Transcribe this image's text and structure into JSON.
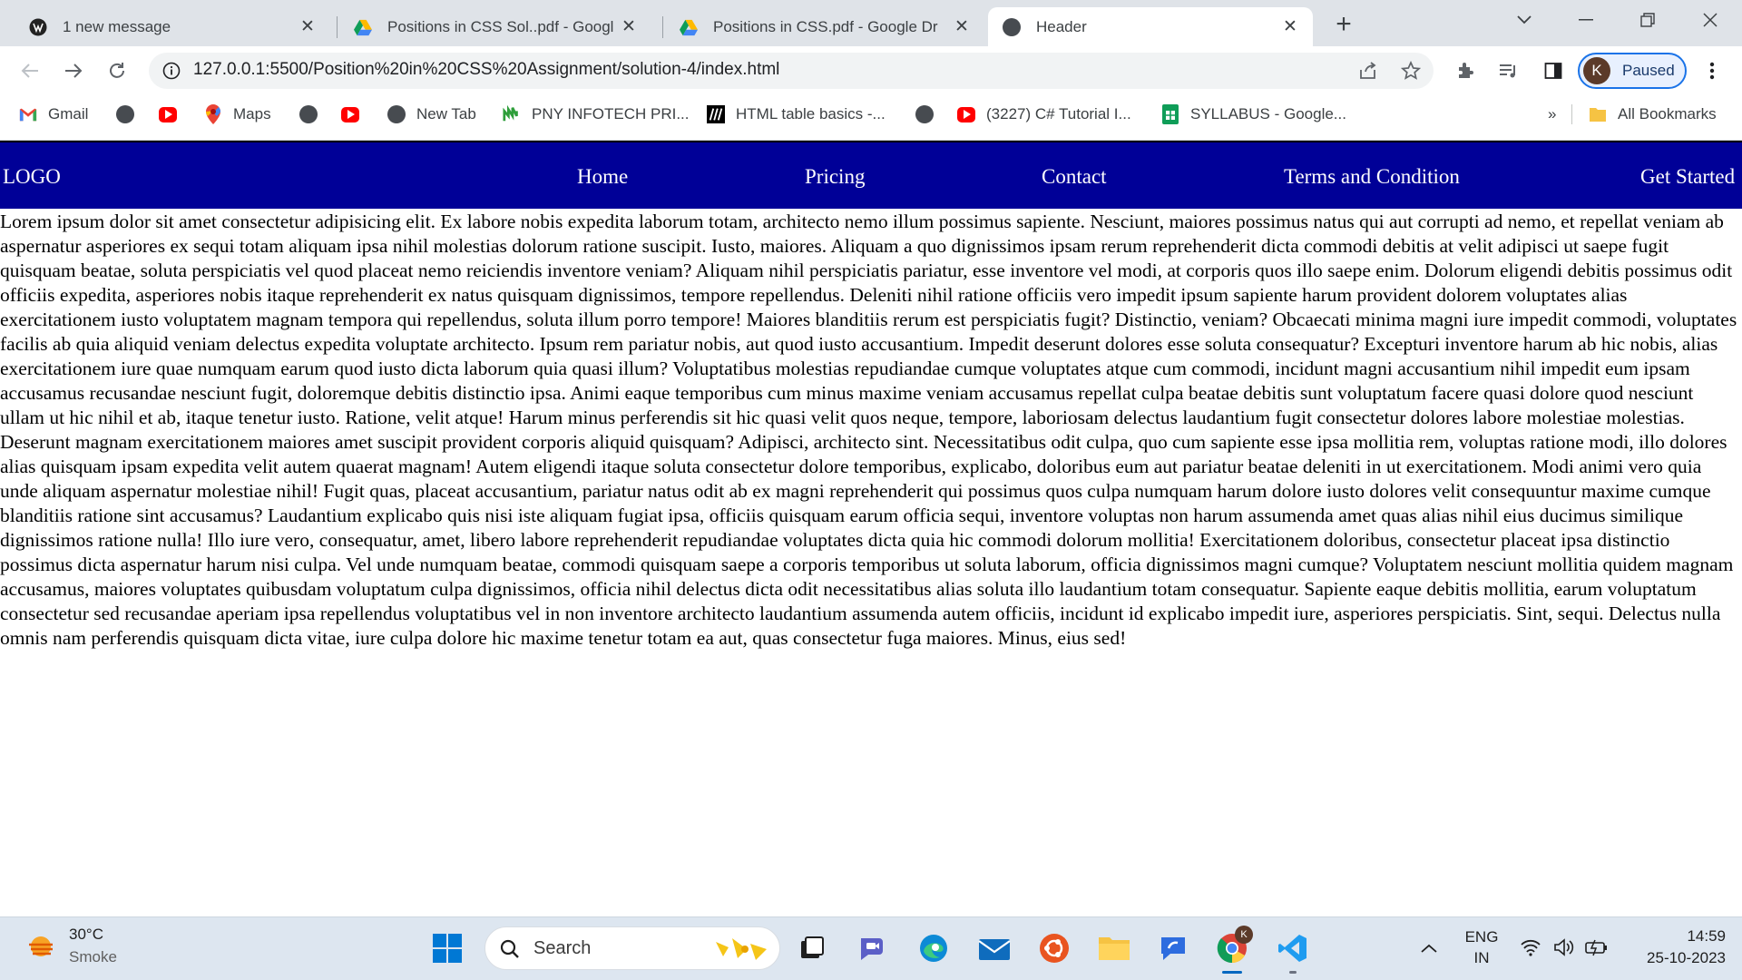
{
  "browser": {
    "tabs": [
      {
        "title": "1 new message",
        "active": false
      },
      {
        "title": "Positions in CSS Sol..pdf - Googl",
        "active": false
      },
      {
        "title": "Positions in CSS.pdf - Google Dr",
        "active": false
      },
      {
        "title": "Header",
        "active": true
      }
    ],
    "url": "127.0.0.1:5500/Position%20in%20CSS%20Assignment/solution-4/index.html",
    "profile": {
      "initial": "K",
      "status": "Paused"
    },
    "bookmarks": [
      {
        "label": "Gmail",
        "icon": "gmail-icon"
      },
      {
        "label": "",
        "icon": "globe-icon"
      },
      {
        "label": "",
        "icon": "youtube-icon"
      },
      {
        "label": "Maps",
        "icon": "maps-icon"
      },
      {
        "label": "",
        "icon": "globe-icon"
      },
      {
        "label": "",
        "icon": "youtube-icon"
      },
      {
        "label": "New Tab",
        "icon": "globe-icon"
      },
      {
        "label": "PNY INFOTECH PRI...",
        "icon": "pny-icon"
      },
      {
        "label": "HTML table basics -...",
        "icon": "mdn-icon"
      },
      {
        "label": "",
        "icon": "globe-icon"
      },
      {
        "label": "(3227) C# Tutorial I...",
        "icon": "youtube-icon"
      },
      {
        "label": "SYLLABUS - Google...",
        "icon": "sheets-icon"
      }
    ],
    "bookmarks_overflow": "»",
    "all_bookmarks": "All Bookmarks"
  },
  "site": {
    "logo": "LOGO",
    "nav": [
      "Home",
      "Pricing",
      "Contact",
      "Terms and Condition"
    ],
    "cta": "Get Started",
    "header_bg": "#000097",
    "body_text": "Lorem ipsum dolor sit amet consectetur adipisicing elit. Ex labore nobis expedita laborum totam, architecto nemo illum possimus sapiente. Nesciunt, maiores possimus natus qui aut corrupti ad nemo, et repellat veniam ab aspernatur asperiores ex sequi totam aliquam ipsa nihil molestias dolorum ratione suscipit. Iusto, maiores. Aliquam a quo dignissimos ipsam rerum reprehenderit dicta commodi debitis at velit adipisci ut saepe fugit quisquam beatae, soluta perspiciatis vel quod placeat nemo reiciendis inventore veniam? Aliquam nihil perspiciatis pariatur, esse inventore vel modi, at corporis quos illo saepe enim. Dolorum eligendi debitis possimus odit officiis expedita, asperiores nobis itaque reprehenderit ex natus quisquam dignissimos, tempore repellendus. Deleniti nihil ratione officiis vero impedit ipsum sapiente harum provident dolorem voluptates alias exercitationem iusto voluptatem magnam tempora qui repellendus, soluta illum porro tempore! Maiores blanditiis rerum est perspiciatis fugit? Distinctio, veniam? Obcaecati minima magni iure impedit commodi, voluptates facilis ab quia aliquid veniam delectus expedita voluptate architecto. Ipsum rem pariatur nobis, aut quod iusto accusantium. Impedit deserunt dolores esse soluta consequatur? Excepturi inventore harum ab hic nobis, alias exercitationem iure quae numquam earum quod iusto dicta laborum quia quasi illum? Voluptatibus molestias repudiandae cumque voluptates atque cum commodi, incidunt magni accusantium nihil impedit eum ipsam accusamus recusandae nesciunt fugit, doloremque debitis distinctio ipsa. Animi eaque temporibus cum minus maxime veniam accusamus repellat culpa beatae debitis sunt voluptatum facere quasi dolore quod nesciunt ullam ut hic nihil et ab, itaque tenetur iusto. Ratione, velit atque! Harum minus perferendis sit hic quasi velit quos neque, tempore, laboriosam delectus laudantium fugit consectetur dolores labore molestiae molestias. Deserunt magnam exercitationem maiores amet suscipit provident corporis aliquid quisquam? Adipisci, architecto sint. Necessitatibus odit culpa, quo cum sapiente esse ipsa mollitia rem, voluptas ratione modi, illo dolores alias quisquam ipsam expedita velit autem quaerat magnam! Autem eligendi itaque soluta consectetur dolore temporibus, explicabo, doloribus eum aut pariatur beatae deleniti in ut exercitationem. Modi animi vero quia unde aliquam aspernatur molestiae nihil! Fugit quas, placeat accusantium, pariatur natus odit ab ex magni reprehenderit qui possimus quos culpa numquam harum dolore iusto dolores velit consequuntur maxime cumque blanditiis ratione sint accusamus? Laudantium explicabo quis nisi iste aliquam fugiat ipsa, officiis quisquam earum officia sequi, inventore voluptas non harum assumenda amet quas alias nihil eius ducimus similique dignissimos ratione nulla! Illo iure vero, consequatur, amet, libero labore reprehenderit repudiandae voluptates dicta quia hic commodi dolorum mollitia! Exercitationem doloribus, consectetur placeat ipsa distinctio possimus dicta aspernatur harum nisi culpa. Vel unde numquam beatae, commodi quisquam saepe a corporis temporibus ut soluta laborum, officia dignissimos magni cumque? Voluptatem nesciunt mollitia quidem magnam accusamus, maiores voluptates quibusdam voluptatum culpa dignissimos, officia nihil delectus dicta odit necessitatibus alias soluta illo laudantium totam consequatur. Sapiente eaque debitis mollitia, earum voluptatum consectetur sed recusandae aperiam ipsa repellendus voluptatibus vel in non inventore architecto laudantium assumenda autem officiis, incidunt id explicabo impedit iure, asperiores perspiciatis. Sint, sequi. Delectus nulla omnis nam perferendis quisquam dicta vitae, iure culpa dolore hic maxime tenetur totam ea aut, quas consectetur fuga maiores. Minus, eius sed!"
  },
  "taskbar": {
    "weather": {
      "temp": "30°C",
      "condition": "Smoke"
    },
    "search_placeholder": "Search",
    "lang_top": "ENG",
    "lang_bottom": "IN",
    "time": "14:59",
    "date": "25-10-2023",
    "chrome_badge": "K"
  }
}
